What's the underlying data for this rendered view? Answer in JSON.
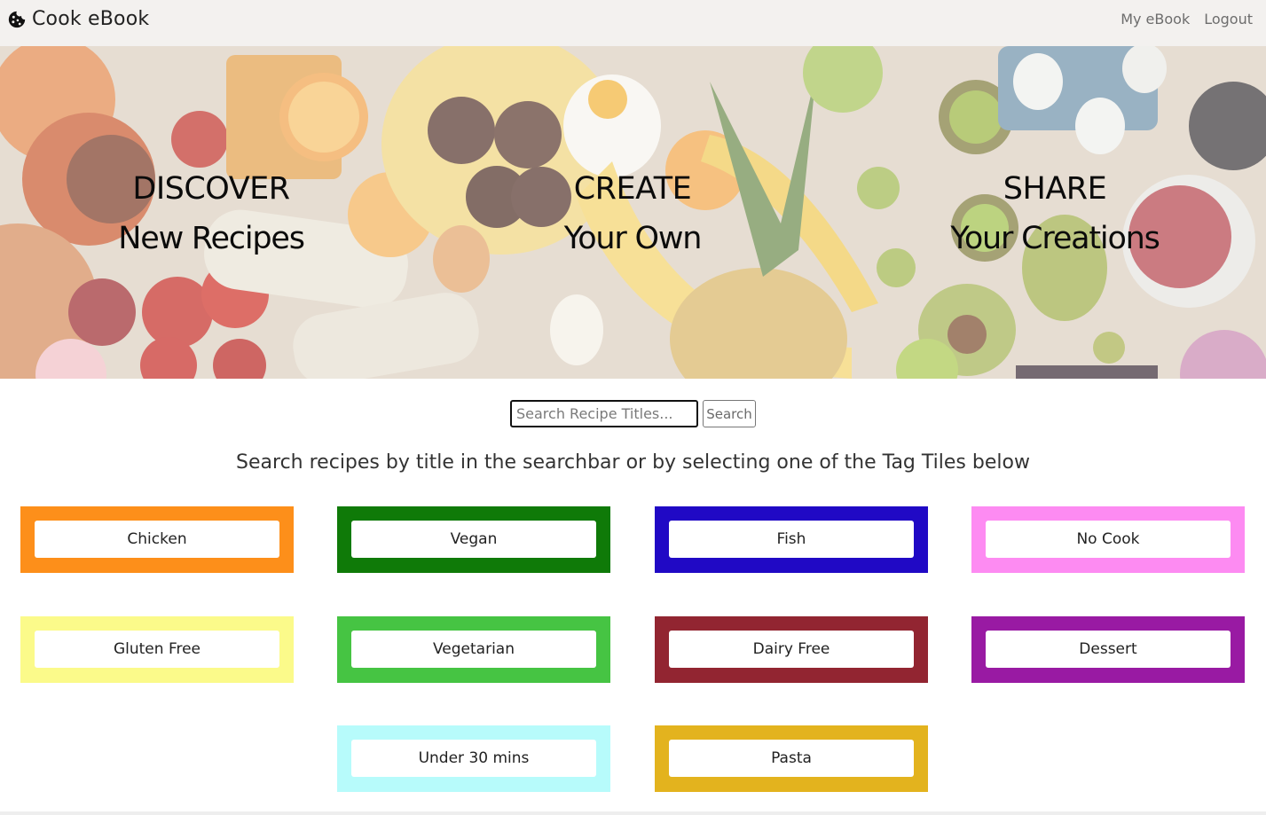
{
  "nav": {
    "brand": "Cook eBook",
    "brand_icon": "cookie-icon",
    "links": [
      "My eBook",
      "Logout"
    ]
  },
  "hero": {
    "columns": [
      {
        "line1": "DISCOVER",
        "line2": "New Recipes"
      },
      {
        "line1": "CREATE",
        "line2": "Your Own"
      },
      {
        "line1": "SHARE",
        "line2": "Your Creations"
      }
    ]
  },
  "search": {
    "placeholder": "Search Recipe Titles...",
    "button_label": "Search"
  },
  "instructions": "Search recipes by title in the searchbar or by selecting one of the Tag Tiles below",
  "tags": [
    {
      "label": "Chicken",
      "color": "#fd8f1a"
    },
    {
      "label": "Vegan",
      "color": "#0f7a08"
    },
    {
      "label": "Fish",
      "color": "#2009c5"
    },
    {
      "label": "No Cook",
      "color": "#fd8bf2"
    },
    {
      "label": "Gluten Free",
      "color": "#fbfa8a"
    },
    {
      "label": "Vegetarian",
      "color": "#46c443"
    },
    {
      "label": "Dairy Free",
      "color": "#922531"
    },
    {
      "label": "Dessert",
      "color": "#991aa3"
    },
    {
      "label": "Under 30 mins",
      "color": "#b7fbfb"
    },
    {
      "label": "Pasta",
      "color": "#e3b31e"
    }
  ]
}
